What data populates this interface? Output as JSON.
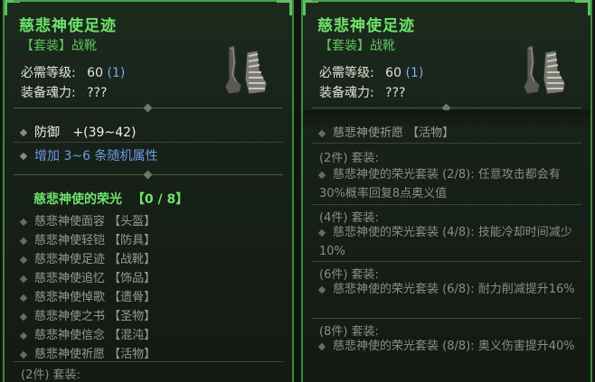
{
  "item": {
    "name": "慈悲神使足迹",
    "type": "【套装】战靴",
    "req_level_label": "必需等级:",
    "req_level_value": "60",
    "req_level_paren": "(1)",
    "soul_label": "装备魂力:",
    "soul_value": "???"
  },
  "stats": {
    "defense_label": "防御",
    "defense_value": "+(39~42)",
    "random_affix": "增加 3~6 条随机属性"
  },
  "set": {
    "name": "慈悲神使的荣光",
    "count": "【0 / 8】",
    "items": [
      "慈悲神使面容 【头盔】",
      "慈悲神使轻铠 【防具】",
      "慈悲神使足迹 【战靴】",
      "慈悲神使追忆 【饰品】",
      "慈悲神使悼歌 【遗骨】",
      "慈悲神使之书 【圣物】",
      "慈悲神使信念 【混沌】",
      "慈悲神使祈愿 【活物】"
    ],
    "partial_top": "慈悲神使祈愿 【活物】",
    "bonus_2_label": "(2件) 套装:",
    "bonus_2_text": "慈悲神使的荣光套装 (2/8): 任意攻击都会有30%概率回复8点奥义值",
    "bonus_4_label": "(4件) 套装:",
    "bonus_4_text": "慈悲神使的荣光套装 (4/8): 技能冷却时间减少10%",
    "bonus_6_label": "(6件) 套装:",
    "bonus_6_text": "慈悲神使的荣光套装 (6/8): 耐力削减提升16%",
    "bonus_8_label": "(8件) 套装:",
    "bonus_8_text": "慈悲神使的荣光套装 (8/8): 奥义伤害提升40%"
  },
  "colors": {
    "title_green": "#6fe36b",
    "frame_green": "#3c8a43",
    "affix_blue": "#6d9be0"
  },
  "icons": {
    "item": "armored-boot-icon"
  }
}
